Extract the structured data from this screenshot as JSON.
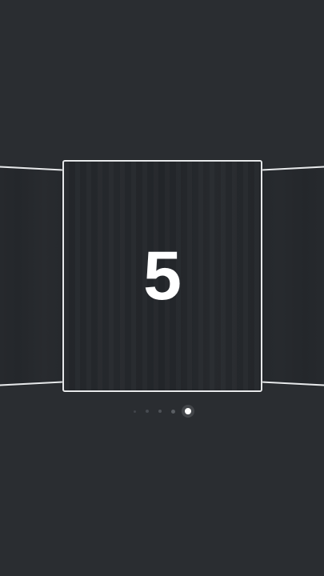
{
  "carousel": {
    "current_card": {
      "label": "5"
    },
    "total_cards": 5,
    "active_index": 5
  },
  "colors": {
    "background": "#2a2d31",
    "card_border": "#e6e8ea",
    "card_text": "#ffffff",
    "dot_active": "#ffffff",
    "dot_inactive": "#4a4e53"
  }
}
